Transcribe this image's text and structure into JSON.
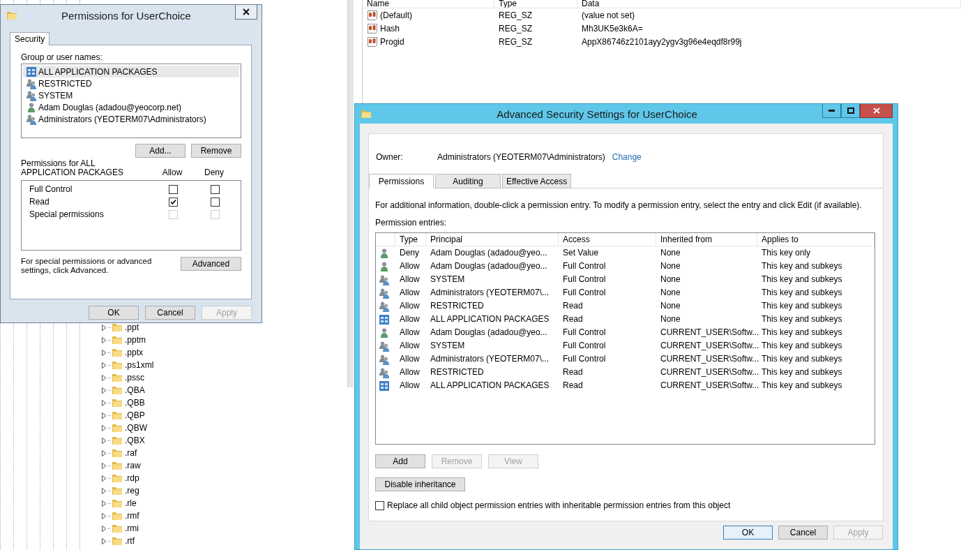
{
  "registry": {
    "tree_items": [
      ".ppt",
      ".pptm",
      ".pptx",
      ".ps1xml",
      ".pssc",
      ".QBA",
      ".QBB",
      ".QBP",
      ".QBW",
      ".QBX",
      ".raf",
      ".raw",
      ".rdp",
      ".reg",
      ".rle",
      ".rmf",
      ".rmi",
      ".rtf"
    ],
    "value_columns": [
      "Name",
      "Type",
      "Data"
    ],
    "values": [
      {
        "name": "(Default)",
        "type": "REG_SZ",
        "data": "(value not set)"
      },
      {
        "name": "Hash",
        "type": "REG_SZ",
        "data": "Mh3UK5e3k6A="
      },
      {
        "name": "Progid",
        "type": "REG_SZ",
        "data": "AppX86746z2101ayy2ygv3g96e4eqdf8r99j"
      }
    ]
  },
  "permissions_dialog": {
    "title": "Permissions for UserChoice",
    "tabs": [
      {
        "label": "Security",
        "selected": true
      }
    ],
    "group_label": "Group or user names:",
    "principals": [
      {
        "name": "ALL APPLICATION PACKAGES",
        "kind": "package",
        "selected": true
      },
      {
        "name": "RESTRICTED",
        "kind": "group",
        "selected": false
      },
      {
        "name": "SYSTEM",
        "kind": "group",
        "selected": false
      },
      {
        "name": "Adam Douglas (adadou@yeocorp.net)",
        "kind": "user",
        "selected": false
      },
      {
        "name": "Administrators (YEOTERM07\\Administrators)",
        "kind": "group",
        "selected": false
      }
    ],
    "list_buttons": [
      {
        "label": "Add...",
        "disabled": false
      },
      {
        "label": "Remove",
        "disabled": false
      }
    ],
    "permissions_label": "Permissions for ALL APPLICATION PACKAGES",
    "allow_header": "Allow",
    "deny_header": "Deny",
    "permissions": [
      {
        "name": "Full Control",
        "allow": {
          "checked": false,
          "disabled": false
        },
        "deny": {
          "checked": false,
          "disabled": false
        }
      },
      {
        "name": "Read",
        "allow": {
          "checked": true,
          "disabled": false
        },
        "deny": {
          "checked": false,
          "disabled": false
        }
      },
      {
        "name": "Special permissions",
        "allow": {
          "checked": false,
          "disabled": true
        },
        "deny": {
          "checked": false,
          "disabled": true
        }
      }
    ],
    "advanced_note": "For special permissions or advanced settings, click Advanced.",
    "advanced_button": "Advanced",
    "footer_buttons": [
      {
        "label": "OK",
        "disabled": false
      },
      {
        "label": "Cancel",
        "disabled": false
      },
      {
        "label": "Apply",
        "disabled": true
      }
    ]
  },
  "advanced_dialog": {
    "title": "Advanced Security Settings for UserChoice",
    "owner_label": "Owner:",
    "owner": "Administrators (YEOTERM07\\Administrators)",
    "owner_link": "Change",
    "tabs": [
      {
        "label": "Permissions",
        "selected": true
      },
      {
        "label": "Auditing",
        "selected": false
      },
      {
        "label": "Effective Access",
        "selected": false
      }
    ],
    "info": "For additional information, double-click a permission entry. To modify a permission entry, select the entry and click Edit (if available).",
    "entries_label": "Permission entries:",
    "columns": [
      "Type",
      "Principal",
      "Access",
      "Inherited from",
      "Applies to"
    ],
    "entries": [
      {
        "kind": "user",
        "type": "Deny",
        "principal": "Adam Douglas (adadou@yeo...",
        "access": "Set Value",
        "inherited_from": "None",
        "applies_to": "This key only"
      },
      {
        "kind": "user",
        "type": "Allow",
        "principal": "Adam Douglas (adadou@yeo...",
        "access": "Full Control",
        "inherited_from": "None",
        "applies_to": "This key and subkeys"
      },
      {
        "kind": "group",
        "type": "Allow",
        "principal": "SYSTEM",
        "access": "Full Control",
        "inherited_from": "None",
        "applies_to": "This key and subkeys"
      },
      {
        "kind": "group",
        "type": "Allow",
        "principal": "Administrators (YEOTERM07\\...",
        "access": "Full Control",
        "inherited_from": "None",
        "applies_to": "This key and subkeys"
      },
      {
        "kind": "group",
        "type": "Allow",
        "principal": "RESTRICTED",
        "access": "Read",
        "inherited_from": "None",
        "applies_to": "This key and subkeys"
      },
      {
        "kind": "package",
        "type": "Allow",
        "principal": "ALL APPLICATION PACKAGES",
        "access": "Read",
        "inherited_from": "None",
        "applies_to": "This key and subkeys"
      },
      {
        "kind": "user",
        "type": "Allow",
        "principal": "Adam Douglas (adadou@yeo...",
        "access": "Full Control",
        "inherited_from": "CURRENT_USER\\Softw...",
        "applies_to": "This key and subkeys"
      },
      {
        "kind": "group",
        "type": "Allow",
        "principal": "SYSTEM",
        "access": "Full Control",
        "inherited_from": "CURRENT_USER\\Softw...",
        "applies_to": "This key and subkeys"
      },
      {
        "kind": "group",
        "type": "Allow",
        "principal": "Administrators (YEOTERM07\\...",
        "access": "Full Control",
        "inherited_from": "CURRENT_USER\\Softw...",
        "applies_to": "This key and subkeys"
      },
      {
        "kind": "group",
        "type": "Allow",
        "principal": "RESTRICTED",
        "access": "Read",
        "inherited_from": "CURRENT_USER\\Softw...",
        "applies_to": "This key and subkeys"
      },
      {
        "kind": "package",
        "type": "Allow",
        "principal": "ALL APPLICATION PACKAGES",
        "access": "Read",
        "inherited_from": "CURRENT_USER\\Softw...",
        "applies_to": "This key and subkeys"
      }
    ],
    "entry_buttons": [
      {
        "label": "Add",
        "disabled": false
      },
      {
        "label": "Remove",
        "disabled": true
      },
      {
        "label": "View",
        "disabled": true
      }
    ],
    "inheritance_button": "Disable inheritance",
    "replace_option": {
      "label": "Replace all child object permission entries with inheritable permission entries from this object",
      "checked": false
    },
    "footer_buttons": [
      {
        "label": "OK",
        "disabled": false,
        "default": true
      },
      {
        "label": "Cancel",
        "disabled": false,
        "default": false
      },
      {
        "label": "Apply",
        "disabled": true,
        "default": false
      }
    ]
  }
}
